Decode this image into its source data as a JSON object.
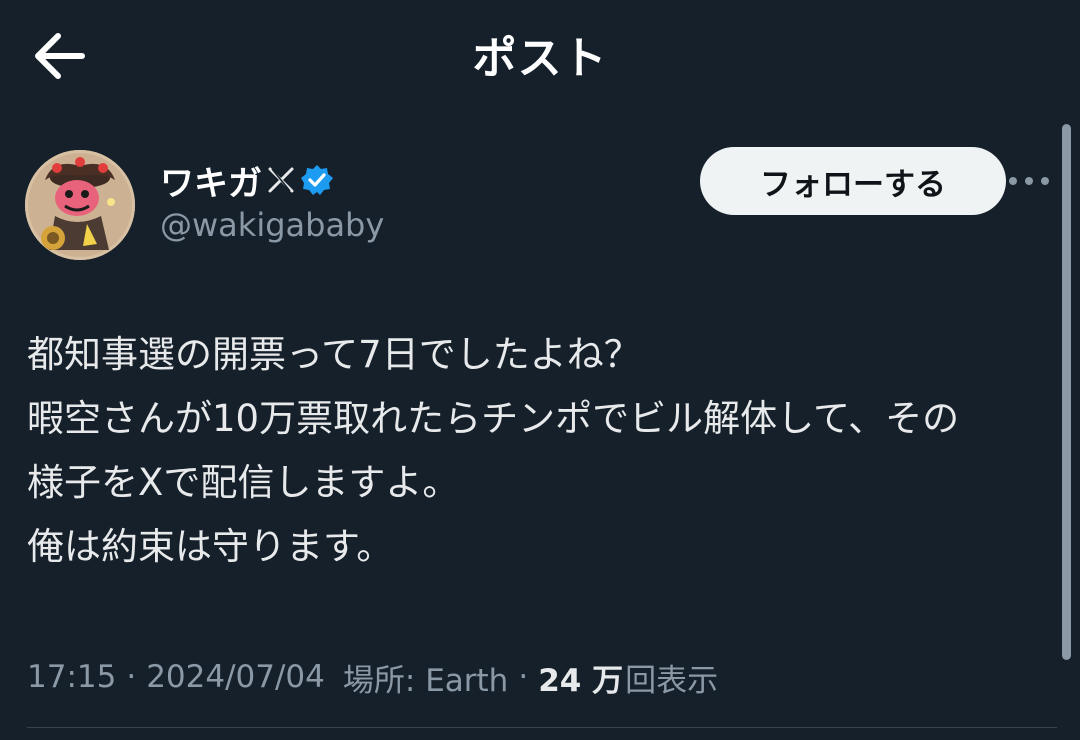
{
  "header": {
    "title": "ポスト",
    "back_icon": "arrow-left-icon"
  },
  "author": {
    "display_name": "ワキガ",
    "handle": "@wakigababy",
    "x_badge_icon": "x-logo-icon",
    "verified_icon": "verified-check-icon",
    "verified_color": "#1d9bf0"
  },
  "actions": {
    "follow_label": "フォローする",
    "more_icon": "more-dots-icon"
  },
  "tweet": {
    "lines": [
      "都知事選の開票って7日でしたよね？",
      "暇空さんが10万票取れたらチンポでビル解体して、その",
      "様子をXで配信しますよ。",
      "俺は約束は守ります。"
    ]
  },
  "meta": {
    "time": "17:15",
    "separator": "·",
    "date": "2024/07/04",
    "location_label": "場所: Earth",
    "views_count": "24 万",
    "views_label": "回表示"
  },
  "colors": {
    "background": "#15202b",
    "text_primary": "#e7e9ea",
    "text_secondary": "#8b98a5",
    "follow_bg": "#eff3f4"
  }
}
